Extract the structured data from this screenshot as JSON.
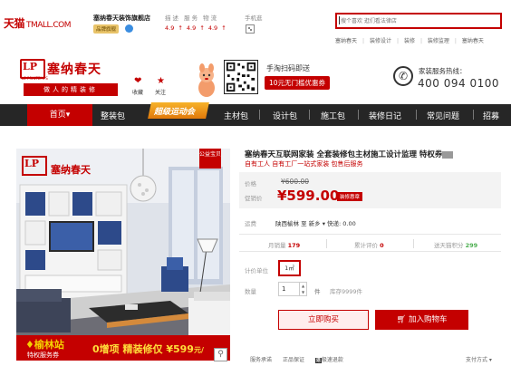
{
  "topbar": {
    "tmall_logo": "天猫",
    "tmall_domain": "TMALL.COM",
    "shop_name": "塞纳春天装饰旗舰店",
    "shop_badge": "品牌旗舰",
    "rating_label": "描述 服务 物流",
    "rating_values": "4.9 ↑ 4.9 ↑ 4.9 ↑",
    "mobile_label": "手机逛",
    "search_placeholder": "搜个喜欢 逛们看法律店",
    "hot_links": [
      "塞纳春天",
      "装修设计",
      "装修",
      "装修监理",
      "塞纳春天"
    ]
  },
  "store": {
    "logo_lp": "LP",
    "name": "塞纳春天",
    "sub": "LE PRINTEMPS",
    "slogan": "做人的精装修",
    "fav_label": "收藏",
    "follow_label": "关注",
    "qr_label": "手淘扫码即送",
    "qr_coupon": "10元无门槛优惠券",
    "service_label": "家装服务热线：",
    "service_phone": "400 094 0100"
  },
  "nav": {
    "home": "首页▾",
    "items": [
      "整装包",
      "主材包",
      "设计包",
      "施工包",
      "装修日记",
      "常见问题",
      "招募"
    ],
    "badge": "超级运动会"
  },
  "product_image": {
    "corner": "公益宝贝",
    "logo_lp": "LP",
    "logo_name": "塞纳春天",
    "station": "榆林站",
    "station_sub": "特权服务券",
    "promo_prefix": "0增项 精装修仅 ",
    "promo_price": "¥599",
    "promo_suffix": "元/",
    "zoom_icon": "magnifier-icon"
  },
  "product": {
    "title": "塞纳春天互联网家装 全套装修包主材施工设计监理 特权券",
    "subtitle": "自有工人 自有工厂一站式家装 包售后服务",
    "price_label": "价格",
    "price_old": "¥600.00",
    "promo_label": "促销价",
    "promo_price": "¥599.00",
    "promo_tag": "装修惠章",
    "ship_label": "运费",
    "ship_value": "陕西榆林 至 新乡 ▾ 快递: 0.00",
    "stats": [
      {
        "label": "月销量",
        "value": "179",
        "style": "red"
      },
      {
        "label": "累计评价",
        "value": "0",
        "style": "red"
      },
      {
        "label": "送天猫积分",
        "value": "299",
        "style": "green"
      }
    ],
    "unit_label": "计价单位",
    "unit_value": "1㎡",
    "qty_label": "数量",
    "qty_value": "1",
    "qty_unit": "件",
    "stock": "库存9999件",
    "buy_label": "立即购买",
    "cart_label": "加入购物车",
    "cart_icon": "cart-icon",
    "bottom_links": [
      "服务承诺",
      "正品保证",
      "极速退款"
    ],
    "pay_mode": "支付方式 ▾"
  },
  "colors": {
    "brand_red": "#c40000",
    "nav_dark": "#262626",
    "badge_orange": "#f7b32b"
  }
}
